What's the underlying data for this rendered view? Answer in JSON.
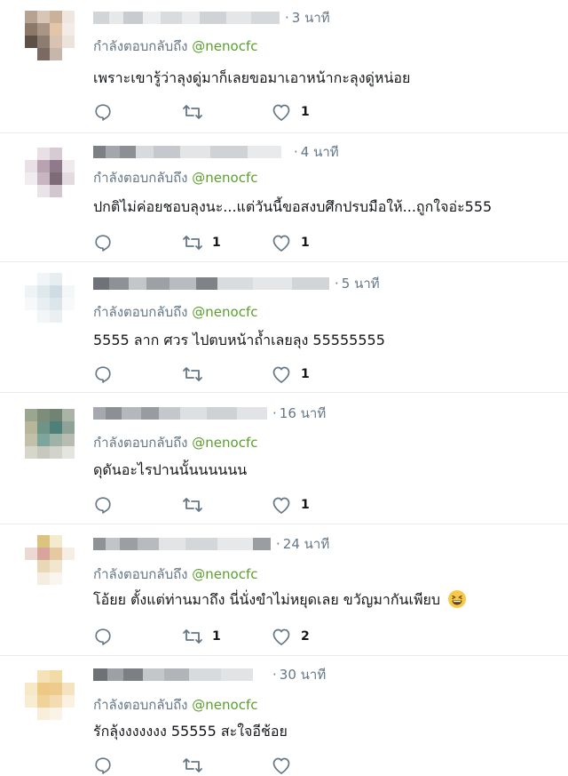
{
  "tweets": [
    {
      "time": "3 นาที",
      "reply_prefix": "กำลังตอบกลับถึง",
      "reply_handle": "@nenocfc",
      "text": "เพราะเขารู้ว่าลุงดู่มาก็เลยขอมาเอาหน้ากะลุงดู่หน่อย",
      "retweets": "",
      "likes": "1"
    },
    {
      "time": "4 นาที",
      "reply_prefix": "กำลังตอบกลับถึง",
      "reply_handle": "@nenocfc",
      "text": "ปกติไม่ค่อยชอบลุงนะ...แต่วันนี้ขอสงบศึกปรบมือให้...ถูกใจอ่ะ555",
      "retweets": "1",
      "likes": "1"
    },
    {
      "time": "5 นาที",
      "reply_prefix": "กำลังตอบกลับถึง",
      "reply_handle": "@nenocfc",
      "text": "5555 ลาก ศวร ไปตบหน้าถ้ำเลยลุง 55555555",
      "retweets": "",
      "likes": "1"
    },
    {
      "time": "16 นาที",
      "reply_prefix": "กำลังตอบกลับถึง",
      "reply_handle": "@nenocfc",
      "text": "ดุดันอะไรปานนั้นนนนนน",
      "retweets": "",
      "likes": "1"
    },
    {
      "time": "24 นาที",
      "reply_prefix": "กำลังตอบกลับถึง",
      "reply_handle": "@nenocfc",
      "text": "โอ้ยย ตั้งแต่ท่านมาถึง นี่นั่งขำไม่หยุดเลย ขวัญมากันเพียบ",
      "retweets": "1",
      "likes": "2"
    },
    {
      "time": "30 นาที",
      "reply_prefix": "กำลังตอบกลับถึง",
      "reply_handle": "@nenocfc",
      "text": "รักลุ้งงงงงงง 55555 สะใจอีช้อย",
      "retweets": "",
      "likes": ""
    }
  ],
  "icons": {
    "reply": "reply-icon",
    "retweet": "retweet-icon",
    "like": "heart-icon",
    "emoji": "grinning-squinting-face-emoji"
  },
  "colors": {
    "handle": "#5b9e2d",
    "muted": "#657786",
    "text": "#14171a",
    "divider": "#e6ecf0"
  }
}
